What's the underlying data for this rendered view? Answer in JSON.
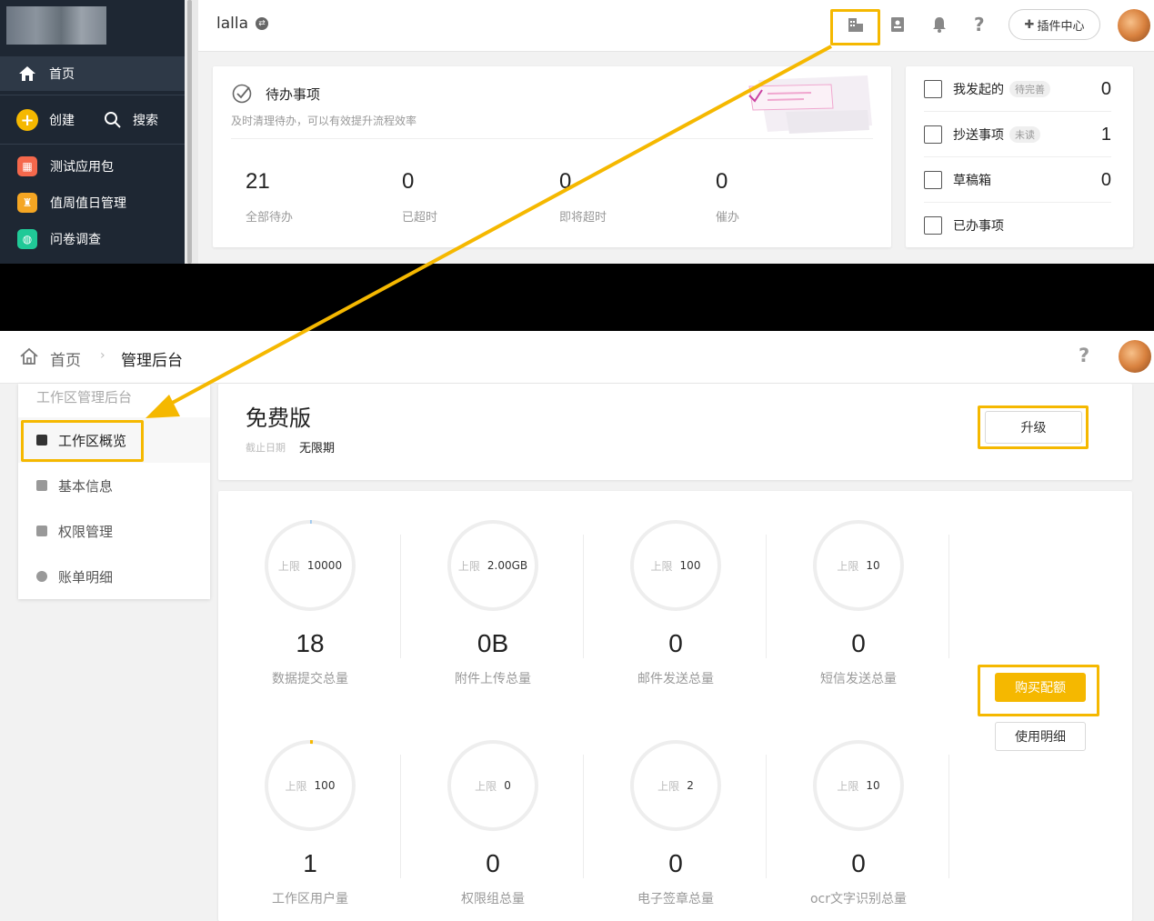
{
  "top": {
    "sidebar": {
      "home": "首页",
      "create": "创建",
      "search": "搜索",
      "apps": [
        {
          "label": "测试应用包",
          "icon": "building-app-icon",
          "color": "#f5684c"
        },
        {
          "label": "值周值日管理",
          "icon": "weights-app-icon",
          "color": "#f5a623"
        },
        {
          "label": "问卷调查",
          "icon": "globe-app-icon",
          "color": "#20c997"
        }
      ]
    },
    "header": {
      "workspace": "lalla",
      "plugin_center": "插件中心"
    },
    "todo": {
      "title": "待办事项",
      "subtitle": "及时清理待办，可以有效提升流程效率",
      "stats": [
        {
          "value": "21",
          "label": "全部待办"
        },
        {
          "value": "0",
          "label": "已超时"
        },
        {
          "value": "0",
          "label": "即将超时"
        },
        {
          "value": "0",
          "label": "催办"
        }
      ]
    },
    "right_list": [
      {
        "label": "我发起的",
        "badge": "待完善",
        "count": "0"
      },
      {
        "label": "抄送事项",
        "badge": "未读",
        "count": "1"
      },
      {
        "label": "草稿箱",
        "badge": "",
        "count": "0"
      },
      {
        "label": "已办事项",
        "badge": "",
        "count": ""
      }
    ]
  },
  "bottom": {
    "breadcrumb": {
      "home": "首页",
      "current": "管理后台"
    },
    "menu": {
      "section": "工作区管理后台",
      "items": [
        "工作区概览",
        "基本信息",
        "权限管理",
        "账单明细"
      ]
    },
    "plan": {
      "name": "免费版",
      "expiry_label": "截止日期",
      "expiry_value": "无限期",
      "upgrade": "升级"
    },
    "limit_prefix": "上限",
    "gauges": [
      {
        "limit": "10000",
        "value": "18",
        "label": "数据提交总量",
        "fill": 0.0018
      },
      {
        "limit": "2.00GB",
        "value": "0B",
        "label": "附件上传总量",
        "fill": 0
      },
      {
        "limit": "100",
        "value": "0",
        "label": "邮件发送总量",
        "fill": 0
      },
      {
        "limit": "10",
        "value": "0",
        "label": "短信发送总量",
        "fill": 0
      },
      {
        "limit": "100",
        "value": "1",
        "label": "工作区用户量",
        "fill": 0.01
      },
      {
        "limit": "0",
        "value": "0",
        "label": "权限组总量",
        "fill": 0
      },
      {
        "limit": "2",
        "value": "0",
        "label": "电子签章总量",
        "fill": 0
      },
      {
        "limit": "10",
        "value": "0",
        "label": "ocr文字识别总量",
        "fill": 0
      }
    ],
    "buy_quota": "购买配额",
    "usage_detail": "使用明细"
  },
  "colors": {
    "accent": "#f5b800",
    "sidebar_bg": "#1e2733"
  }
}
